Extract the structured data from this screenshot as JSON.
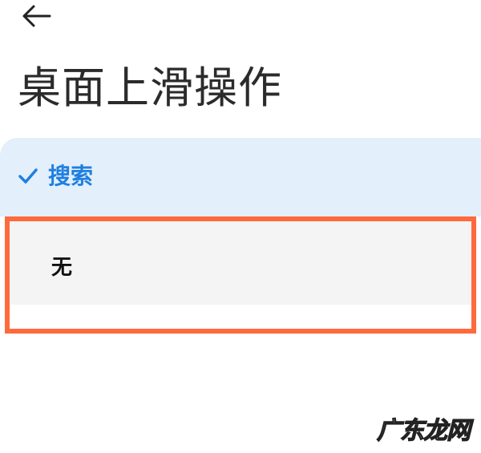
{
  "header": {
    "back_icon": "arrow-left-icon",
    "title": "桌面上滑操作"
  },
  "options": [
    {
      "label": "搜索",
      "selected": true,
      "icon": "checkmark-icon"
    },
    {
      "label": "无",
      "selected": false,
      "highlighted": true
    }
  ],
  "watermark": {
    "text": "广东龙网"
  },
  "colors": {
    "selected_bg": "#e3effb",
    "selected_text": "#1f7fe0",
    "highlight_border": "#ff6a3d",
    "unselected_bg": "#f4f4f4",
    "title_text": "#2b2b2b"
  }
}
